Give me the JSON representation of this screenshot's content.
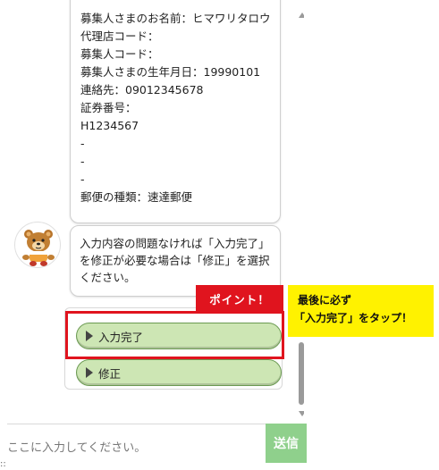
{
  "chat": {
    "confirm_lines": [
      "募集人さまのお名前：ヒマワリタロウ",
      "代理店コード：",
      "募集人コード：",
      "募集人さまの生年月日：19990101",
      "連絡先：09012345678",
      "証券番号：",
      "H1234567",
      "-",
      "-",
      "-",
      "郵便の種類：速達郵便"
    ],
    "bot_message_lines": [
      "入力内容の問題なければ「入力完了」",
      "を修正が必要な場合は「修正」を選択",
      "ください。"
    ],
    "choices": [
      {
        "label": "入力完了",
        "icon": "play-triangle-icon"
      },
      {
        "label": "修正",
        "icon": "play-triangle-icon"
      }
    ]
  },
  "annotation": {
    "badge": "ポイント！",
    "note_line1": "最後に必ず",
    "note_line2": "「入力完了」をタップ！",
    "frame_color": "#e0141e",
    "note_bg": "#fff200"
  },
  "input": {
    "placeholder": "ここに入力してください。",
    "send_label": "送信",
    "send_color": "#8fd08c"
  },
  "misc": {
    "corner_text": "::"
  }
}
